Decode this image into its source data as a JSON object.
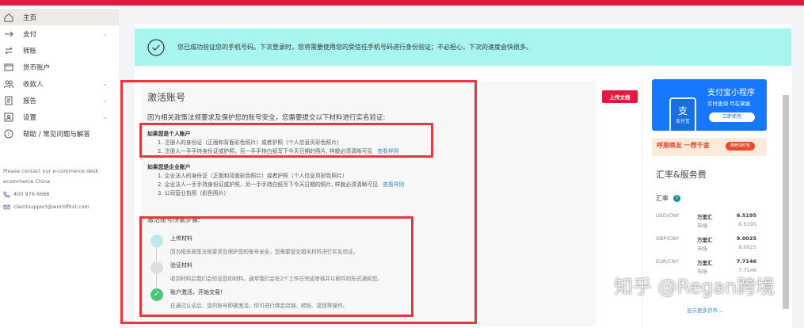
{
  "sidebar": {
    "items": [
      {
        "label": "主页",
        "icon": "home-icon",
        "active": true
      },
      {
        "label": "支付",
        "icon": "arrow-right-icon",
        "chevron": true
      },
      {
        "label": "转账",
        "icon": "transfer-icon"
      },
      {
        "label": "货币账户",
        "icon": "wallet-icon"
      },
      {
        "label": "收款人",
        "icon": "users-icon",
        "chevron": true
      },
      {
        "label": "报告",
        "icon": "report-icon",
        "chevron": true
      },
      {
        "label": "设置",
        "icon": "settings-icon",
        "chevron": true
      },
      {
        "label": "帮助 / 常见问题与解答",
        "icon": "help-icon"
      }
    ],
    "contact": {
      "line1": "Please contact our e-commerce desk",
      "line2": "ecommerce China",
      "phone": "400 976 6666",
      "email": "clientsupport@worldfirst.com"
    }
  },
  "banner": {
    "text": "您已成功验证您的手机号码。下次登录时，您将需要使用您的受信任手机号码进行身份验证；不必担心，下次的速度会快很多。"
  },
  "activate": {
    "title": "激活账号",
    "upload_button": "上传文档",
    "intro": "因为相关政策法规要求及保护您的账号安全，您需要提交以下材料进行实名验证:",
    "personal": {
      "heading": "如果您是个人账户",
      "items": [
        "1. 注册人的身份证（正面和背面彩色照片）或者护照（个人信息页彩色照片）",
        "2. 注册人一手手持身份证或护照，另一手手持白纸写下今天日期的照片, 样貌必须清晰可见"
      ],
      "link": "查看样例"
    },
    "business": {
      "heading": "如果您是企业账户",
      "items": [
        "1. 企业法人的身份证（正面和背面彩色照片）或者护照（个人信息页彩色照片）",
        "2. 企业法人一手手持身份证或护照，另一手手持白纸写下今天日期的照片, 样貌必须清晰可见",
        "3. 公司营业执照（彩色照片）"
      ],
      "link": "查看样例"
    },
    "steps_title": "激活账号所需步骤:",
    "steps": [
      {
        "title": "上传材料",
        "desc": "因为相关政策法规要求及保护您的账号安全，您需要提交相关材料进行实名验证。"
      },
      {
        "title": "验证材料",
        "desc": "收到材料后我们会验证您的材料。通常我们会在2个工作日完成审核并以邮件的形式通知您。"
      },
      {
        "title": "账户激活，开始交易！",
        "desc": "在通过认证后，您的账号即被激活。你可进行绑定店铺、转账、提现等操作。"
      }
    ]
  },
  "ads": {
    "alipay": {
      "title": "支付宝小程序",
      "subtitle": "实时查询 尽在掌握",
      "button": "立即使用",
      "logo": "支付宝"
    },
    "referral": {
      "title": "呼朋唤友 一荐千金",
      "button": "推荐领红包"
    }
  },
  "rates": {
    "title": "汇率&服务费",
    "label": "汇率",
    "rows": [
      {
        "pair": "USD/CNY",
        "wf_label": "万里汇",
        "wf": "6.5195",
        "mk_label": "市场",
        "mk": "6.5195"
      },
      {
        "pair": "GBP/CNY",
        "wf_label": "万里汇",
        "wf": "9.0025",
        "mk_label": "市场",
        "mk": "9.0025"
      },
      {
        "pair": "EUR/CNY",
        "wf_label": "万里汇",
        "wf": "7.7146",
        "mk_label": "市场",
        "mk": "7.7146"
      }
    ],
    "more": "显示更多货币"
  },
  "watermark": "知乎 @Regan跨境",
  "colors": {
    "brand": "#e0193f",
    "banner": "#a8f5ee",
    "link": "#3b8fc4"
  }
}
